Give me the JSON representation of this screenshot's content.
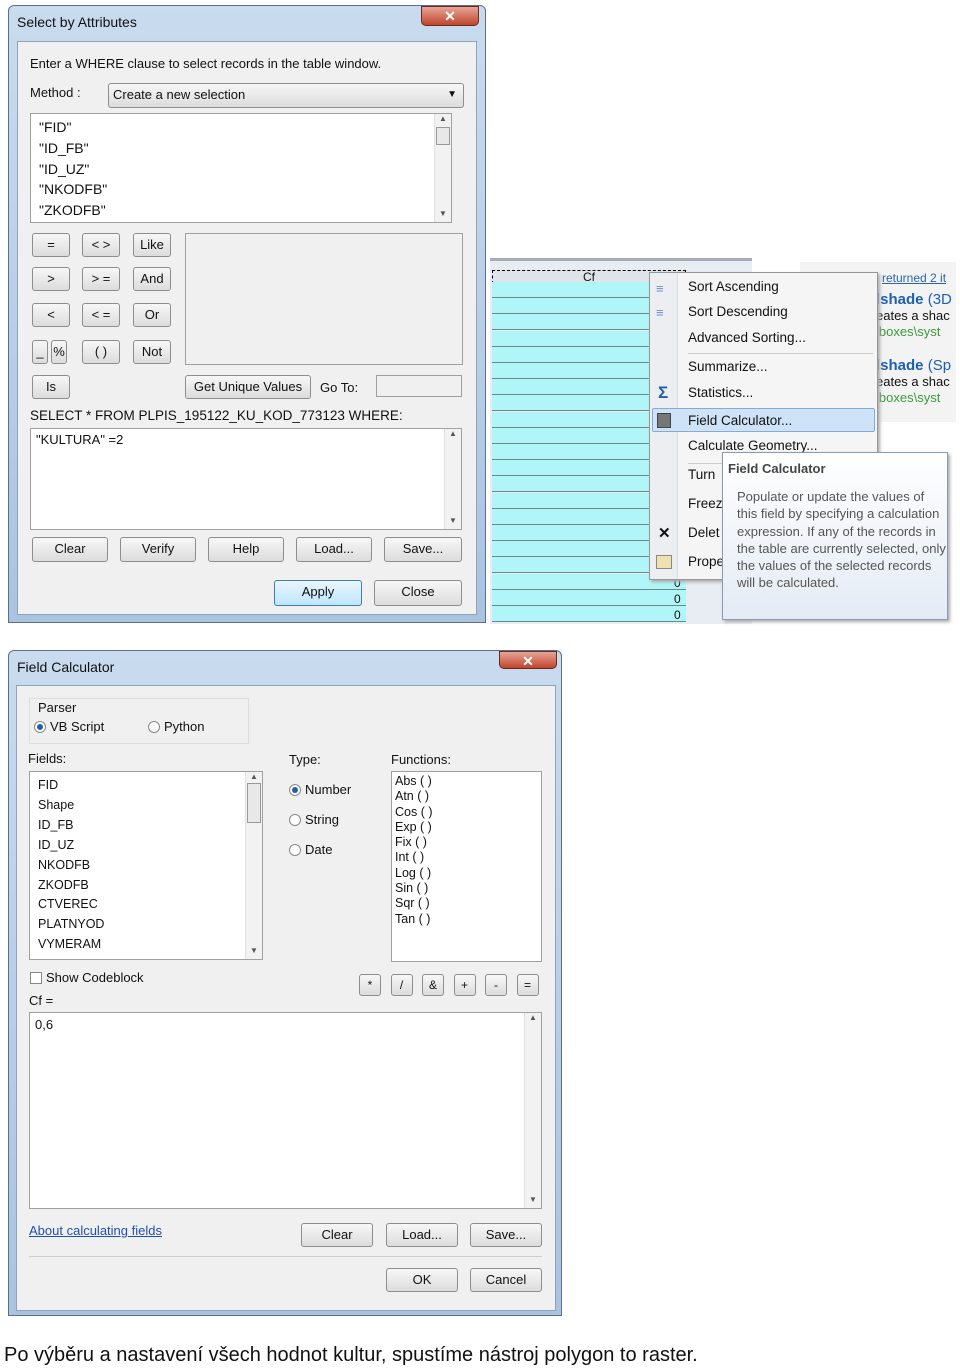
{
  "select_dialog": {
    "title": "Select by Attributes",
    "close": "✕",
    "instruction": "Enter a WHERE clause to select records in the table window.",
    "method_label": "Method :",
    "method_value": "Create a new selection",
    "fields": [
      "\"FID\"",
      "\"ID_FB\"",
      "\"ID_UZ\"",
      "\"NKODFB\"",
      "\"ZKODFB\""
    ],
    "operators": [
      "=",
      "< >",
      "Like",
      ">",
      "> =",
      "And",
      "<",
      "< =",
      "Or",
      "_",
      "%",
      "( )",
      "Not",
      "Is"
    ],
    "get_unique": "Get Unique Values",
    "goto": "Go To:",
    "sql_prefix": "SELECT * FROM PLPIS_195122_KU_KOD_773123 WHERE:",
    "expression": "\"KULTURA\" =2",
    "buttons": {
      "clear": "Clear",
      "verify": "Verify",
      "help": "Help",
      "load": "Load...",
      "save": "Save...",
      "apply": "Apply",
      "close": "Close"
    }
  },
  "table": {
    "column": "Cf",
    "values": [
      "0",
      "0",
      "0"
    ]
  },
  "context_menu": {
    "items": [
      "Sort Ascending",
      "Sort Descending",
      "Advanced Sorting...",
      "Summarize...",
      "Statistics...",
      "Field Calculator...",
      "Calculate Geometry...",
      "Turn",
      "Freez",
      "Delet",
      "Prope"
    ],
    "highlighted": "Field Calculator..."
  },
  "tooltip": {
    "title": "Field Calculator",
    "body": "Populate or update the values of this field by specifying a calculation expression. If any of the records in the table are currently selected, only the values of the selected records will be calculated."
  },
  "search_results": {
    "header": "returned 2 it",
    "items": [
      {
        "title": "lshade",
        "suffix": "(3D",
        "desc": "eates a shac",
        "path": "lboxes\\syst"
      },
      {
        "title": "lshade",
        "suffix": "(Sp",
        "desc": "eates a shac",
        "path": "lboxes\\syst"
      }
    ]
  },
  "field_calc": {
    "title": "Field Calculator",
    "close": "✕",
    "parser_label": "Parser",
    "parser_options": [
      "VB Script",
      "Python"
    ],
    "parser_selected": "VB Script",
    "fields_label": "Fields:",
    "fields": [
      "FID",
      "Shape",
      "ID_FB",
      "ID_UZ",
      "NKODFB",
      "ZKODFB",
      "CTVEREC",
      "PLATNYOD",
      "VYMERAM"
    ],
    "type_label": "Type:",
    "types": [
      "Number",
      "String",
      "Date"
    ],
    "type_selected": "Number",
    "functions_label": "Functions:",
    "functions": [
      "Abs ( )",
      "Atn ( )",
      "Cos ( )",
      "Exp ( )",
      "Fix ( )",
      "Int ( )",
      "Log ( )",
      "Sin ( )",
      "Sqr ( )",
      "Tan ( )"
    ],
    "show_codeblock": "Show Codeblock",
    "show_codeblock_checked": false,
    "operators": [
      "*",
      "/",
      "&",
      "+",
      "-",
      "="
    ],
    "target": "Cf =",
    "expression": "0,6",
    "about_link": "About calculating fields",
    "buttons": {
      "clear": "Clear",
      "load": "Load...",
      "save": "Save...",
      "ok": "OK",
      "cancel": "Cancel"
    }
  },
  "caption": "Po výběru a nastavení všech hodnot kultur, spustíme nástroj polygon to raster."
}
